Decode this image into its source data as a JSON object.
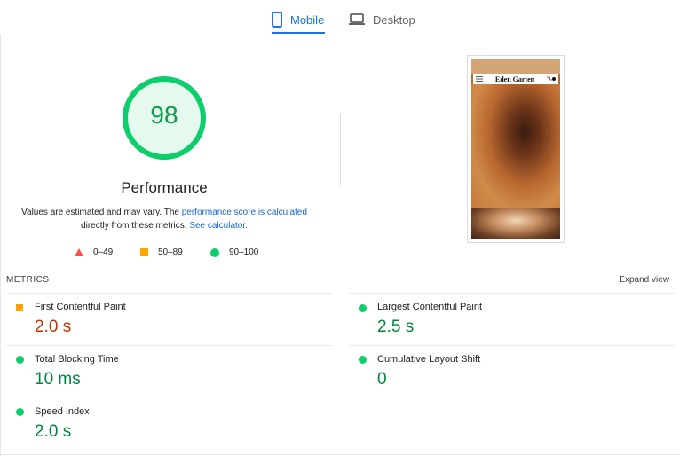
{
  "tabs": {
    "mobile": "Mobile",
    "desktop": "Desktop"
  },
  "performance": {
    "score": "98",
    "title": "Performance",
    "description_before": "Values are estimated and may vary. The ",
    "description_link": "performance score is calculated",
    "description_middle": " directly from these metrics. ",
    "calculator_link": "See calculator."
  },
  "legend": {
    "fail": "0–49",
    "average": "50–89",
    "pass": "90–100"
  },
  "thumbnail": {
    "brand": "Eden Garten"
  },
  "metrics": {
    "title": "METRICS",
    "expand": "Expand view",
    "fcp": {
      "label": "First Contentful Paint",
      "value": "2.0 s",
      "status": "average"
    },
    "lcp": {
      "label": "Largest Contentful Paint",
      "value": "2.5 s",
      "status": "pass"
    },
    "tbt": {
      "label": "Total Blocking Time",
      "value": "10 ms",
      "status": "pass"
    },
    "cls": {
      "label": "Cumulative Layout Shift",
      "value": "0",
      "status": "pass"
    },
    "si": {
      "label": "Speed Index",
      "value": "2.0 s",
      "status": "pass"
    }
  },
  "colors": {
    "accent": "#1a73e8",
    "pass": "#0cce6b",
    "average": "#ffa400",
    "fail": "#ff4e42",
    "value_average": "#c33300",
    "value_pass": "#018642"
  }
}
